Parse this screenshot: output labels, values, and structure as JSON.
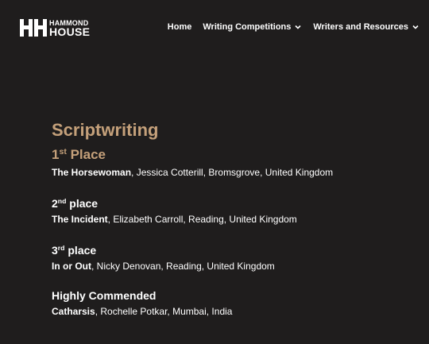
{
  "header": {
    "logo": {
      "mark_letters": "HH",
      "top_text": "HAMMOND",
      "bottom_text": "HOUSE"
    },
    "nav": [
      {
        "label": "Home",
        "has_dropdown": false
      },
      {
        "label": "Writing Competitions",
        "has_dropdown": true
      },
      {
        "label": "Writers and Resources",
        "has_dropdown": true
      }
    ]
  },
  "main": {
    "title": "Scriptwriting",
    "results": [
      {
        "place_number": "1",
        "place_suffix": "st",
        "place_word": "Place",
        "work": "The Horsewoman",
        "details": ", Jessica Cotterill, Bromsgrove, United Kingdom"
      },
      {
        "place_number": "2",
        "place_suffix": "nd",
        "place_word": "place",
        "work": "The Incident",
        "details": ", Elizabeth Carroll, Reading, United Kingdom"
      },
      {
        "place_number": "3",
        "place_suffix": "rd",
        "place_word": "place",
        "work": "In or Out",
        "details": ", Nicky Denovan, Reading, United Kingdom"
      },
      {
        "place_label": "Highly Commended",
        "work": "Catharsis",
        "details": ", Rochelle Potkar, Mumbai, India"
      }
    ]
  },
  "colors": {
    "background": "#1f1d1d",
    "accent": "#c4a07a",
    "text": "#ffffff"
  }
}
